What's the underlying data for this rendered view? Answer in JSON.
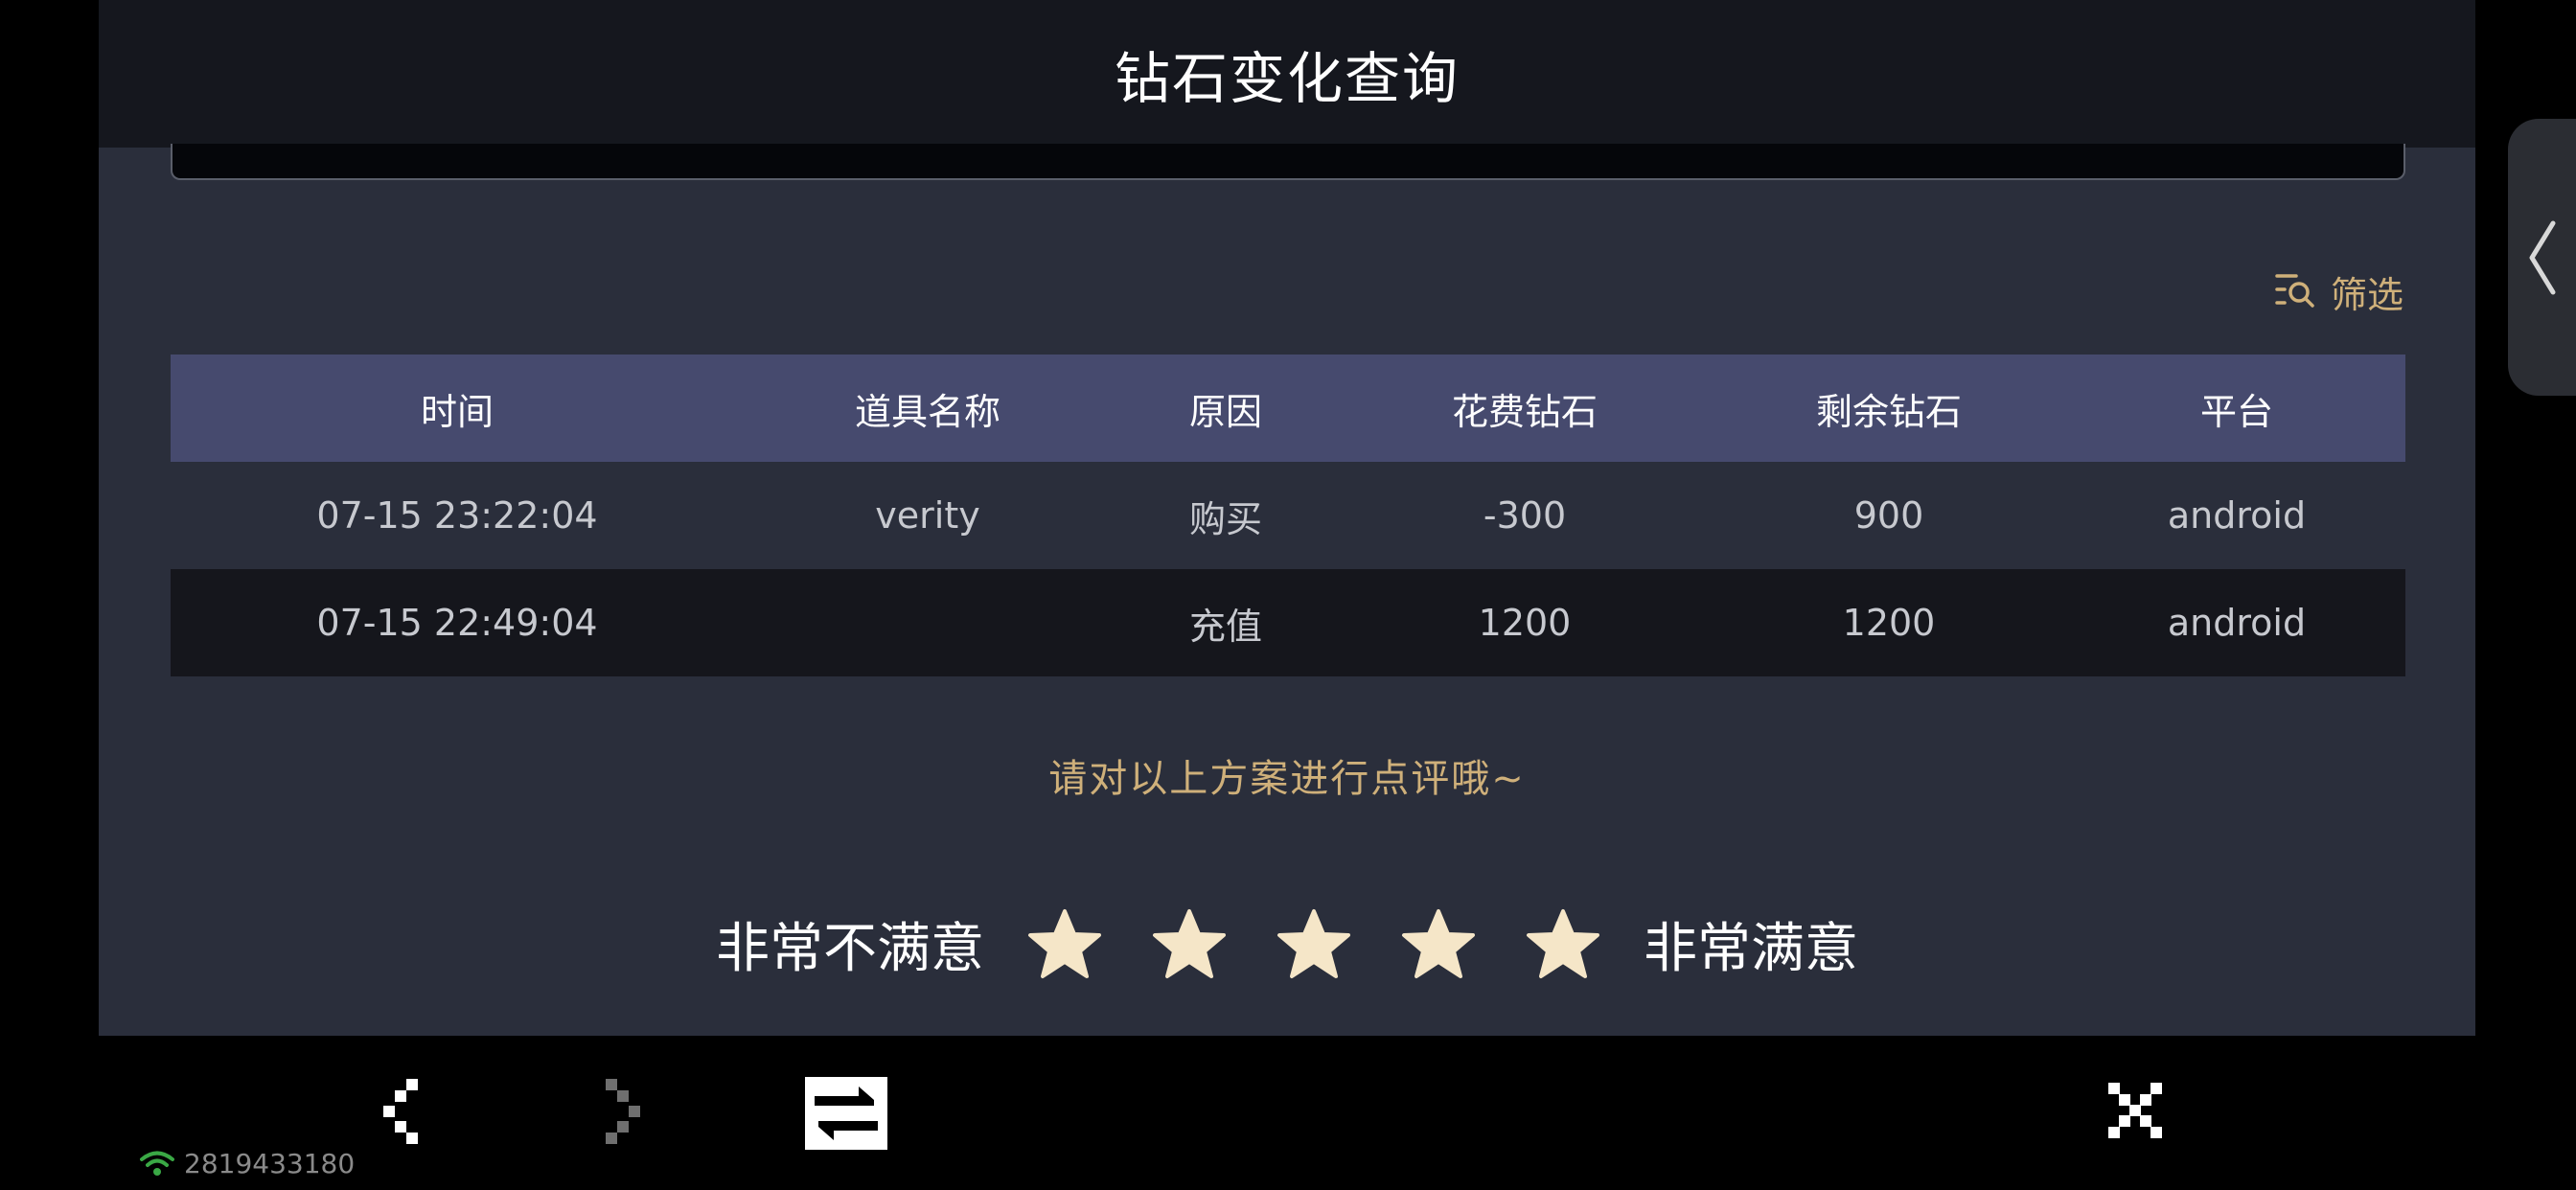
{
  "header": {
    "title": "钻石变化查询"
  },
  "filter": {
    "label": "筛选",
    "icon": "filter-search-icon"
  },
  "table": {
    "columns": [
      "时间",
      "道具名称",
      "原因",
      "花费钻石",
      "剩余钻石",
      "平台"
    ],
    "rows": [
      [
        "07-15 23:22:04",
        "verity",
        "购买",
        "-300",
        "900",
        "android"
      ],
      [
        "07-15 22:49:04",
        "",
        "充值",
        "1200",
        "1200",
        "android"
      ]
    ]
  },
  "rating": {
    "prompt": "请对以上方案进行点评哦~",
    "low_label": "非常不满意",
    "high_label": "非常满意",
    "star_count": 5,
    "star_color": "#f5e6c8"
  },
  "colors": {
    "accent": "#cfb07a",
    "header_bg": "#15171e",
    "panel_bg": "#2a2e3b",
    "table_head_bg": "#464a6e"
  },
  "bottom_bar": {
    "back_icon": "chevron-left-icon",
    "forward_icon": "chevron-right-icon",
    "refresh_icon": "refresh-icon",
    "close_icon": "close-icon"
  },
  "status": {
    "wifi_icon": "wifi-icon",
    "id": "2819433180"
  }
}
